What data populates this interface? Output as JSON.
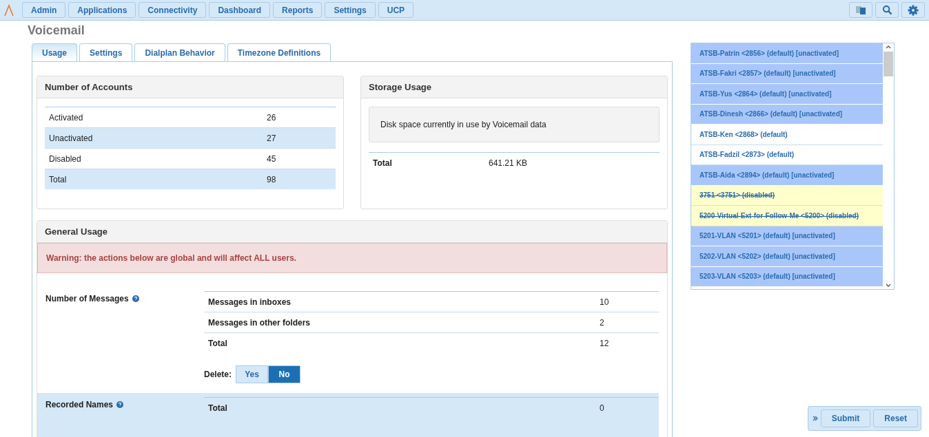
{
  "nav": {
    "items": [
      "Admin",
      "Applications",
      "Connectivity",
      "Dashboard",
      "Reports",
      "Settings",
      "UCP"
    ]
  },
  "page_title": "Voicemail",
  "tabs": [
    {
      "label": "Usage",
      "selected": true
    },
    {
      "label": "Settings",
      "selected": false
    },
    {
      "label": "Dialplan Behavior",
      "selected": false
    },
    {
      "label": "Timezone Definitions",
      "selected": false
    }
  ],
  "accounts": {
    "title": "Number of Accounts",
    "rows": [
      {
        "label": "Activated",
        "value": "26"
      },
      {
        "label": "Unactivated",
        "value": "27"
      },
      {
        "label": "Disabled",
        "value": "45"
      },
      {
        "label": "Total",
        "value": "98"
      }
    ]
  },
  "storage": {
    "title": "Storage Usage",
    "note": "Disk space currently in use by Voicemail data",
    "total_label": "Total",
    "total_value": "641.21 KB"
  },
  "general": {
    "title": "General Usage",
    "warning": "Warning: the actions below are global and will affect ALL users.",
    "sections": [
      {
        "label": "Number of Messages",
        "highlighted": false,
        "rows": [
          {
            "label": "Messages in inboxes",
            "value": "10"
          },
          {
            "label": "Messages in other folders",
            "value": "2"
          },
          {
            "label": "Total",
            "value": "12"
          }
        ],
        "delete_label": "Delete:",
        "options": [
          {
            "label": "Yes",
            "selected": false
          },
          {
            "label": "No",
            "selected": true
          }
        ]
      },
      {
        "label": "Recorded Names",
        "highlighted": true,
        "rows": [
          {
            "label": "Total",
            "value": "0"
          }
        ]
      }
    ]
  },
  "extensions": [
    {
      "label": "ATSB-Patrin <2856>  (default) [unactivated]",
      "kind": "unactivated"
    },
    {
      "label": "ATSB-Fakri <2857>  (default) [unactivated]",
      "kind": "unactivated"
    },
    {
      "label": "ATSB-Yus <2864>  (default) [unactivated]",
      "kind": "unactivated"
    },
    {
      "label": "ATSB-Dinesh <2866>  (default) [unactivated]",
      "kind": "unactivated"
    },
    {
      "label": "ATSB-Ken <2868>  (default)",
      "kind": "active"
    },
    {
      "label": "ATSB-Fadzil <2873>  (default)",
      "kind": "active"
    },
    {
      "label": "ATSB-Aida <2894>  (default) [unactivated]",
      "kind": "unactivated"
    },
    {
      "label": "3751 <3751>  (disabled)",
      "kind": "disabled"
    },
    {
      "label": "5200-Virtual-Ext-for-Follow-Me <5200>  (disabled)",
      "kind": "disabled"
    },
    {
      "label": "5201-VLAN <5201>  (default) [unactivated]",
      "kind": "unactivated"
    },
    {
      "label": "5202-VLAN <5202>  (default) [unactivated]",
      "kind": "unactivated"
    },
    {
      "label": "5203-VLAN <5203>  (default) [unactivated]",
      "kind": "unactivated"
    }
  ],
  "actions": [
    "Submit",
    "Reset"
  ]
}
